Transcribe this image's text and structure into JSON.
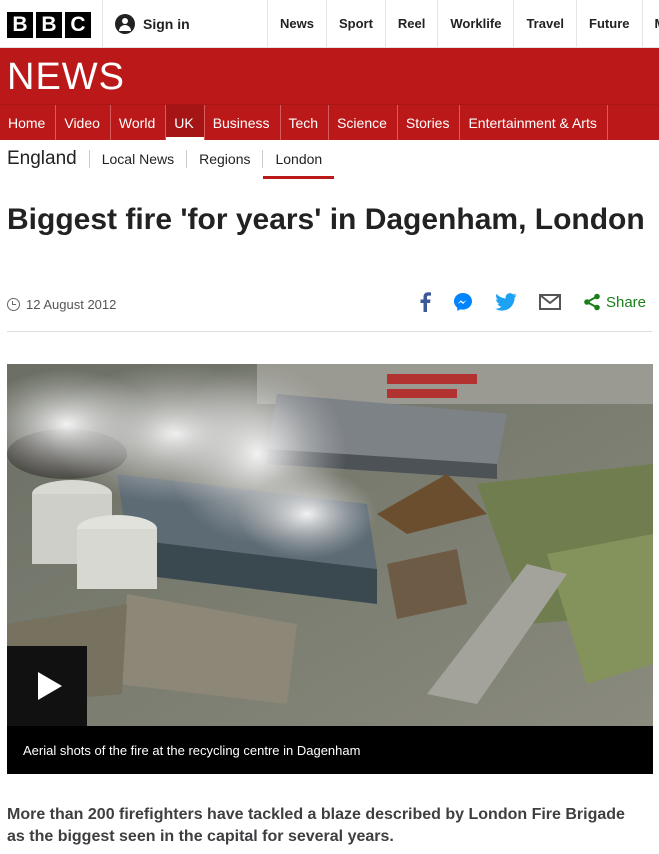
{
  "brand": {
    "letters": [
      "B",
      "B",
      "C"
    ]
  },
  "topbar": {
    "signin_label": "Sign in",
    "nav": [
      "News",
      "Sport",
      "Reel",
      "Worklife",
      "Travel",
      "Future",
      "M"
    ]
  },
  "news_banner": {
    "title": "NEWS",
    "color": "#bb1919"
  },
  "section_nav": {
    "items": [
      "Home",
      "Video",
      "World",
      "UK",
      "Business",
      "Tech",
      "Science",
      "Stories",
      "Entertainment & Arts"
    ],
    "active": "UK"
  },
  "sub_nav": {
    "region": "England",
    "items": [
      "Local News",
      "Regions",
      "London"
    ],
    "active": "London"
  },
  "article": {
    "headline": "Biggest fire 'for years' in Dagenham, London",
    "date": "12 August 2012",
    "share_label": "Share",
    "share_icons": [
      "facebook-icon",
      "messenger-icon",
      "twitter-icon",
      "email-icon",
      "share-icon"
    ],
    "media_caption": "Aerial shots of the fire at the recycling centre in Dagenham",
    "intro": "More than 200 firefighters have tackled a blaze described by London Fire Brigade as the biggest seen in the capital for several years."
  }
}
